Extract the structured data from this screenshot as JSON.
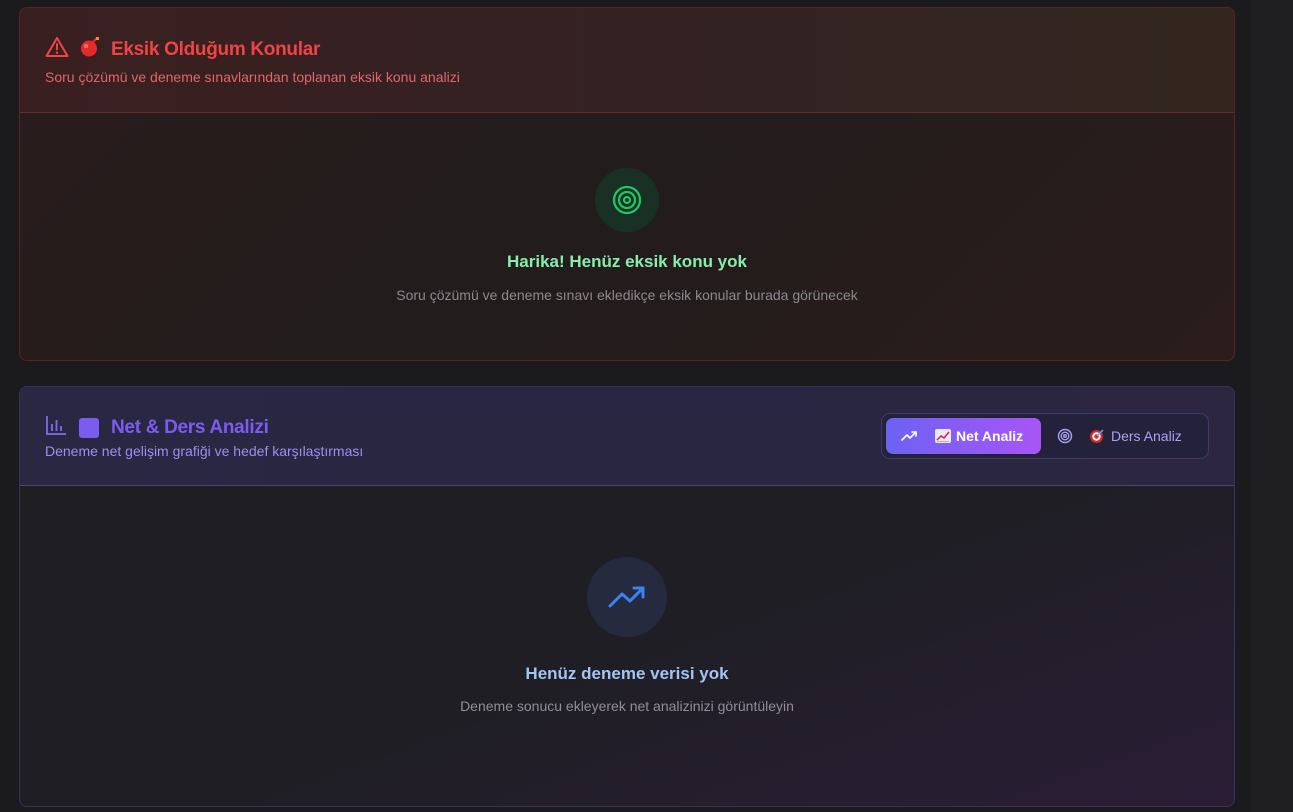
{
  "weak_topics": {
    "title": "Eksik Olduğum Konular",
    "subtitle": "Soru çözümü ve deneme sınavlarından toplanan eksik konu analizi",
    "title_icons": [
      "warning-triangle-icon",
      "bomb-emoji-icon"
    ],
    "empty_state": {
      "icon": "target-icon",
      "title": "Harika! Henüz eksik konu yok",
      "description": "Soru çözümü ve deneme sınavı ekledikçe eksik konular burada görünecek"
    },
    "accent_color": "#ef4444"
  },
  "net_analysis": {
    "title": "Net & Ders Analizi",
    "subtitle": "Deneme net gelişim grafiği ve hedef karşılaştırması",
    "title_icons": [
      "bar-chart-icon",
      "purple-square-emoji-icon"
    ],
    "tabs": [
      {
        "label": "📈 Net Analiz",
        "icon": "trending-up-icon",
        "active": true
      },
      {
        "label": "🎯 Ders Analiz",
        "icon": "target-icon",
        "active": false
      }
    ],
    "tab_labels": {
      "net": "Net Analiz",
      "ders": "Ders Analiz"
    },
    "empty_state": {
      "icon": "trending-up-icon",
      "title": "Henüz deneme verisi yok",
      "description": "Deneme sonucu ekleyerek net analizinizi görüntüleyin"
    },
    "accent_color": "#7c5cf0"
  }
}
